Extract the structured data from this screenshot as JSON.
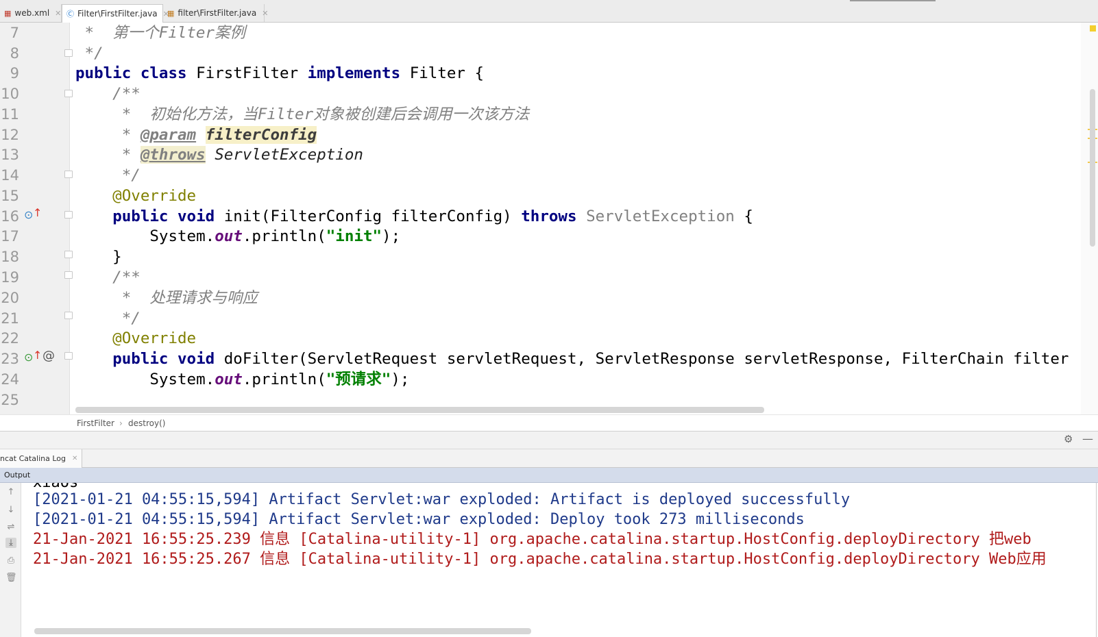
{
  "tabs": [
    {
      "label": "web.xml",
      "icon": "xml-file-icon"
    },
    {
      "label": "Filter\\FirstFilter.java",
      "icon": "java-class-icon",
      "active": true
    },
    {
      "label": "filter\\FirstFilter.java",
      "icon": "java-file-icon"
    }
  ],
  "editor": {
    "line_numbers": [
      "7",
      "8",
      "9",
      "10",
      "11",
      "12",
      "13",
      "14",
      "15",
      "16",
      "17",
      "18",
      "19",
      "20",
      "21",
      "22",
      "23",
      "24",
      "25"
    ],
    "lines": {
      "l7": " *  第一个Filter案例",
      "l8": " */",
      "l9_kw1": "public",
      "l9_kw2": "class",
      "l9_name": "FirstFilter",
      "l9_kw3": "implements",
      "l9_rest": "Filter {",
      "l10": "    /**",
      "l11": "     *  初始化方法，当Filter对象被创建后会调用一次该方法",
      "l12_star": "     * ",
      "l12_tag": "@param",
      "l12_name": "filterConfig",
      "l13_star": "     * ",
      "l13_tag": "@throws",
      "l13_rest": " ServletException",
      "l14": "     */",
      "l15": "    @Override",
      "l16_kw1": "public",
      "l16_kw2": "void",
      "l16_mid": "init(FilterConfig filterConfig)",
      "l16_kw3": "throws",
      "l16_exc": "ServletException",
      "l16_end": "{",
      "l17_pre": "        System.",
      "l17_fld": "out",
      "l17_mid": ".println(",
      "l17_str": "\"init\"",
      "l17_end": ");",
      "l18": "    }",
      "l19": "    /**",
      "l20": "     *  处理请求与响应",
      "l21": "     */",
      "l22": "    @Override",
      "l23_kw1": "public",
      "l23_kw2": "void",
      "l23_rest": "doFilter(ServletRequest servletRequest, ServletResponse servletResponse, FilterChain filter",
      "l24_pre": "        System.",
      "l24_fld": "out",
      "l24_mid": ".println(",
      "l24_str": "\"预请求\"",
      "l24_end": ");"
    }
  },
  "breadcrumb": [
    "FirstFilter",
    "destroy()"
  ],
  "tool_window": {
    "tab_label": "ncat Catalina Log",
    "output_label": "Output"
  },
  "console_lines": [
    {
      "text": "xiaos",
      "color": "black"
    },
    {
      "text": "[2021-01-21 04:55:15,594] Artifact Servlet:war exploded: Artifact is deployed successfully",
      "color": "blue"
    },
    {
      "text": "[2021-01-21 04:55:15,594] Artifact Servlet:war exploded: Deploy took 273 milliseconds",
      "color": "blue"
    },
    {
      "text": "21-Jan-2021 16:55:25.239 信息 [Catalina-utility-1] org.apache.catalina.startup.HostConfig.deployDirectory 把web",
      "color": "red"
    },
    {
      "text": "21-Jan-2021 16:55:25.267 信息 [Catalina-utility-1] org.apache.catalina.startup.HostConfig.deployDirectory Web应用",
      "color": "red"
    }
  ],
  "colors": {
    "keyword": "#000080",
    "comment": "#808080",
    "annotation": "#808000",
    "string": "#008000",
    "console_blue": "#1f3a8a",
    "console_red": "#b01b1b"
  }
}
